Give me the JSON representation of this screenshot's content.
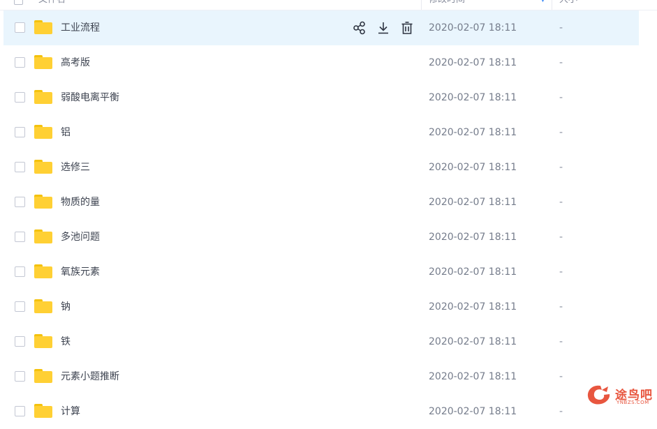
{
  "header": {
    "name_label": "文件名",
    "modified_label": "修改时间",
    "size_label": "大小"
  },
  "colors": {
    "folder": "#ffd034",
    "row_hover": "#e9f5fd",
    "accent": "#3f8cf7",
    "watermark": "#e8563f"
  },
  "row_actions": {
    "icons": [
      "share-icon",
      "download-icon",
      "delete-icon"
    ]
  },
  "rows": [
    {
      "name": "工业流程",
      "modified": "2020-02-07 18:11",
      "size": "-"
    },
    {
      "name": "高考版",
      "modified": "2020-02-07 18:11",
      "size": "-"
    },
    {
      "name": "弱酸电离平衡",
      "modified": "2020-02-07 18:11",
      "size": "-"
    },
    {
      "name": "铝",
      "modified": "2020-02-07 18:11",
      "size": "-"
    },
    {
      "name": "选修三",
      "modified": "2020-02-07 18:11",
      "size": "-"
    },
    {
      "name": "物质的量",
      "modified": "2020-02-07 18:11",
      "size": "-"
    },
    {
      "name": "多池问题",
      "modified": "2020-02-07 18:11",
      "size": "-"
    },
    {
      "name": "氧族元素",
      "modified": "2020-02-07 18:11",
      "size": "-"
    },
    {
      "name": "钠",
      "modified": "2020-02-07 18:11",
      "size": "-"
    },
    {
      "name": "铁",
      "modified": "2020-02-07 18:11",
      "size": "-"
    },
    {
      "name": "元素小题推断",
      "modified": "2020-02-07 18:11",
      "size": "-"
    },
    {
      "name": "计算",
      "modified": "2020-02-07 18:11",
      "size": "-"
    }
  ],
  "watermark": {
    "text": "途鸟吧",
    "domain": "YNBZS.COM"
  }
}
